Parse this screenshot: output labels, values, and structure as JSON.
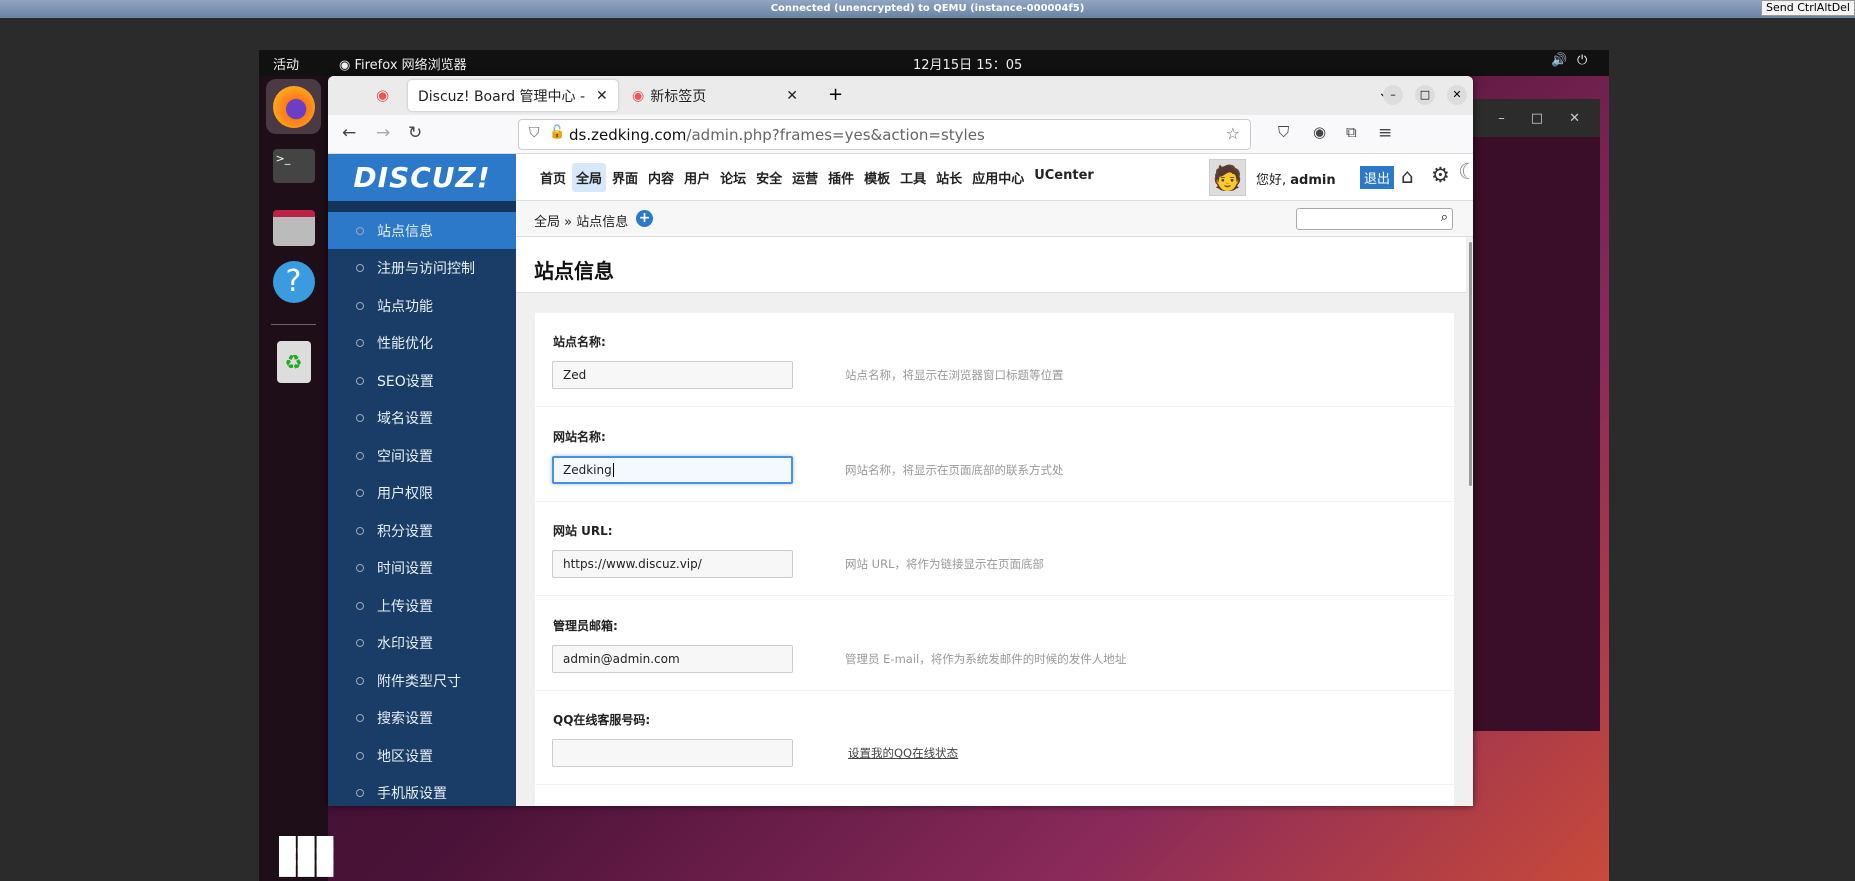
{
  "vnc": {
    "title": "Connected (unencrypted) to QEMU (instance-000004f5)",
    "ctrl_alt_del": "Send CtrlAltDel"
  },
  "panel": {
    "activities": "活动",
    "app": "Firefox 网络浏览器",
    "clock": "12月15日  15：05"
  },
  "browser": {
    "tabs": [
      {
        "label": "Discuz! Board 管理中心 - 全局",
        "active": true
      },
      {
        "label": "新标签页",
        "active": false
      }
    ],
    "url_host": "ds.zedking.com",
    "url_path": "/admin.php?frames=yes&action=styles"
  },
  "admin": {
    "logo": "DISCUZ!",
    "topnav": [
      "首页",
      "全局",
      "界面",
      "内容",
      "用户",
      "论坛",
      "安全",
      "运营",
      "插件",
      "模板",
      "工具",
      "站长",
      "应用中心",
      "UCenter"
    ],
    "active_topnav": "全局",
    "greeting": "您好, ",
    "username": "admin",
    "logout": "退出",
    "breadcrumb": "全局 » 站点信息",
    "sidebar": [
      "站点信息",
      "注册与访问控制",
      "站点功能",
      "性能优化",
      "SEO设置",
      "域名设置",
      "空间设置",
      "用户权限",
      "积分设置",
      "时间设置",
      "上传设置",
      "水印设置",
      "附件类型尺寸",
      "搜索设置",
      "地区设置",
      "手机版设置"
    ],
    "page_title": "站点信息",
    "fields": [
      {
        "label": "站点名称:",
        "value": "Zed",
        "hint": "站点名称，将显示在浏览器窗口标题等位置"
      },
      {
        "label": "网站名称:",
        "value": "Zedking",
        "hint": "网站名称，将显示在页面底部的联系方式处"
      },
      {
        "label": "网站 URL:",
        "value": "https://www.discuz.vip/",
        "hint": "网站 URL，将作为链接显示在页面底部"
      },
      {
        "label": "管理员邮箱:",
        "value": "admin@admin.com",
        "hint": "管理员 E-mail，将作为系统发邮件的时候的发件人地址"
      },
      {
        "label": "QQ在线客服号码:",
        "value": "",
        "hint": "设置我的QQ在线状态"
      }
    ]
  }
}
